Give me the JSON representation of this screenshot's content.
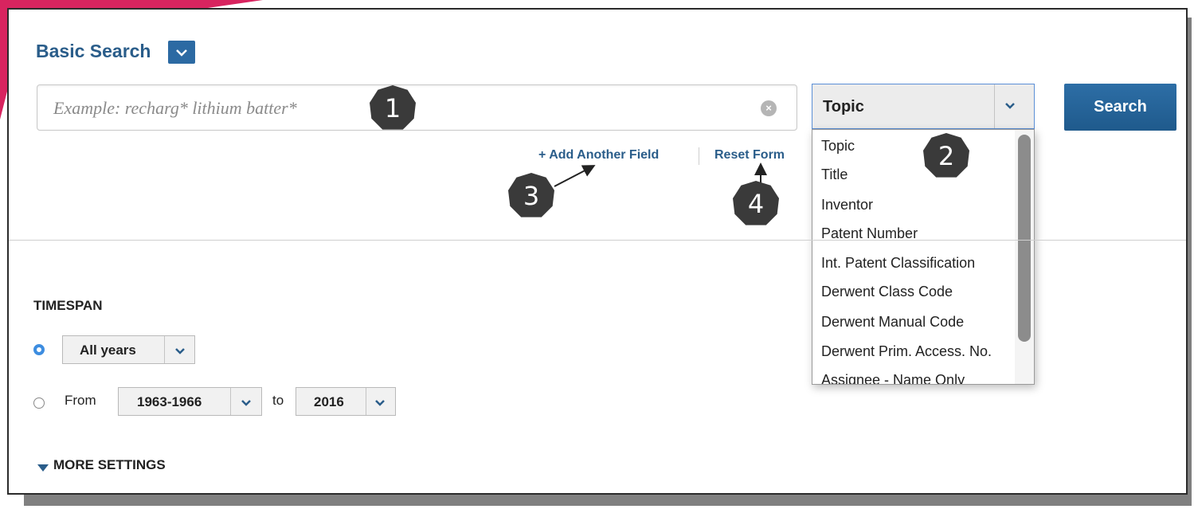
{
  "basic_search": {
    "title": "Basic Search",
    "input_placeholder": "Example: recharg* lithium batter*",
    "field_selected": "Topic",
    "search_button": "Search",
    "add_field_link": "+ Add Another Field",
    "reset_link": "Reset Form"
  },
  "field_options": [
    "Topic",
    "Title",
    "Inventor",
    "Patent Number",
    "Int. Patent Classification",
    "Derwent Class Code",
    "Derwent Manual Code",
    "Derwent Prim. Access. No.",
    "Assignee - Name Only"
  ],
  "timespan": {
    "label": "TIMESPAN",
    "all_years": "All years",
    "from_label": "From",
    "from_value": "1963-1966",
    "to_label": "to",
    "to_value": "2016"
  },
  "more_settings": "MORE SETTINGS",
  "callouts": [
    "1",
    "2",
    "3",
    "4"
  ],
  "colors": {
    "accent": "#2c6aa3",
    "brand": "#d8245f",
    "badge": "#3a3a3a"
  }
}
